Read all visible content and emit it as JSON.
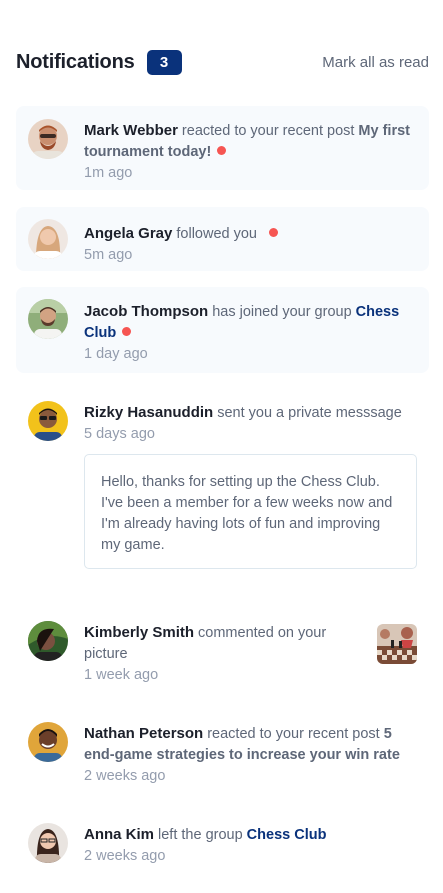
{
  "header": {
    "title": "Notifications",
    "count": "3",
    "mark_all": "Mark all as read"
  },
  "notifications": [
    {
      "name": "Mark Webber",
      "action": "reacted to your recent post",
      "target": "My first tournament today!",
      "time": "1m ago",
      "unread": true,
      "avatar_icon": "avatar-mark-webber"
    },
    {
      "name": "Angela Gray",
      "action": "followed you",
      "target": "",
      "time": "5m ago",
      "unread": true,
      "avatar_icon": "avatar-angela-gray"
    },
    {
      "name": "Jacob Thompson",
      "action": "has joined your group",
      "target": "Chess Club",
      "time": "1 day ago",
      "unread": true,
      "avatar_icon": "avatar-jacob-thompson"
    },
    {
      "name": "Rizky Hasanuddin",
      "action": "sent you a private messsage",
      "target": "",
      "time": "5 days ago",
      "unread": false,
      "message": "Hello, thanks for setting up the Chess Club. I've been a member for a few weeks now and I'm already having lots of fun and improving my game.",
      "avatar_icon": "avatar-rizky-hasanuddin"
    },
    {
      "name": "Kimberly Smith",
      "action": "commented on your picture",
      "target": "",
      "time": "1 week ago",
      "unread": false,
      "avatar_icon": "avatar-kimberly-smith",
      "thumbnail_icon": "chess-picture-thumbnail"
    },
    {
      "name": "Nathan Peterson",
      "action": "reacted to your recent post",
      "target": "5 end-game strategies to increase your win rate",
      "time": "2 weeks ago",
      "unread": false,
      "avatar_icon": "avatar-nathan-peterson"
    },
    {
      "name": "Anna Kim",
      "action": "left the group",
      "target": "Chess Club",
      "time": "2 weeks ago",
      "unread": false,
      "avatar_icon": "avatar-anna-kim"
    }
  ],
  "colors": {
    "accent": "#0a327b",
    "unread_dot": "#f65552",
    "unread_bg": "#f7fafd",
    "name_text": "#1c202b",
    "body_text": "#5e6778",
    "muted_text": "#939cad"
  }
}
